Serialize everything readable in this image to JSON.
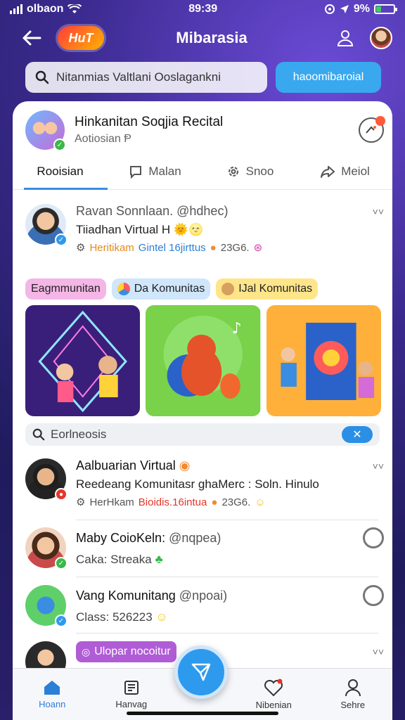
{
  "status_bar": {
    "carrier": "olbaon",
    "time": "89:39",
    "battery": "9%"
  },
  "header": {
    "logo_text": "HuT",
    "title": "Mibarasia"
  },
  "search": {
    "placeholder": "Nitanmias Valtlani Ooslagankni",
    "button": "haoomibaroial"
  },
  "profile": {
    "name": "Hinkanitan Soqjia Recital",
    "subtitle": "Aotiosian"
  },
  "tabs": [
    {
      "label": "Rooisian",
      "icon": "none"
    },
    {
      "label": "Malan",
      "icon": "message-square-icon"
    },
    {
      "label": "Snoo",
      "icon": "gear-icon"
    },
    {
      "label": "Meiol",
      "icon": "share-icon"
    }
  ],
  "post1": {
    "name": "Ravan Sonnlaan.",
    "handle": "@hdhec)",
    "line": "Tiiadhan Virtual H",
    "meta_a": "Heritikam",
    "meta_b": "Gintel 16jirttus",
    "meta_c": "23G6."
  },
  "chips": [
    {
      "label": "Eagmmunitan",
      "bg": "#f4b6e6"
    },
    {
      "label": "Da Komunitas",
      "bg": "#cfe6fb"
    },
    {
      "label": "IJal Komunitas",
      "bg": "#ffe58a"
    }
  ],
  "search2": {
    "text": "Eorlneosis",
    "clear": "✕"
  },
  "post2": {
    "name": "Aalbuarian Virtual",
    "line": "Reedeang Komunitasr ghaMerc : Soln. Hinulo",
    "meta_a": "HerHkam",
    "meta_b": "Bioidis.16intua",
    "meta_c": "23G6."
  },
  "post3": {
    "name": "Maby CoioKeln:",
    "handle": "@nqpea)",
    "line": "Caka: Streaka"
  },
  "post4": {
    "name": "Vang Komunitang",
    "handle": "@npoai)",
    "line": "Class: 526223"
  },
  "post5": {
    "chip": "Ulopar nocoitur"
  },
  "bottom_nav": [
    {
      "label": "Hoann",
      "icon": "home-icon"
    },
    {
      "label": "Hanvag",
      "icon": "document-icon"
    },
    {
      "label": "Nibenian",
      "icon": "heart-notification-icon"
    },
    {
      "label": "Sehre",
      "icon": "person-icon"
    }
  ],
  "colors": {
    "accent": "#2e9aee",
    "tab_underline": "#3a8de0",
    "badge_green": "#3bb84a"
  }
}
